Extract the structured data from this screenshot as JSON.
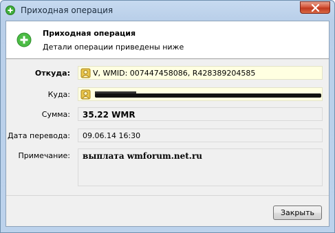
{
  "window": {
    "title": "Приходная операция",
    "close_icon": "close-icon"
  },
  "header": {
    "title": "Приходная операция",
    "subtitle": "Детали операции приведены ниже",
    "icon": "plus-circle-icon"
  },
  "fields": {
    "from_label": "Откуда:",
    "from_value": "V, WMID: 007447458086, R428389204585",
    "to_label": "Куда:",
    "amount_label": "Сумма:",
    "amount_value": "35.22 WMR",
    "date_label": "Дата перевода:",
    "date_value": "09.06.14 16:30",
    "note_label": "Примечание:",
    "note_value": "выплата wmforum.net.ru"
  },
  "buttons": {
    "close_label": "Закрыть"
  },
  "colors": {
    "field_highlight": "#ffffe1",
    "title_gradient": "#c7daf0",
    "close_button": "#c0391f",
    "accent_green": "#3fae3a"
  }
}
